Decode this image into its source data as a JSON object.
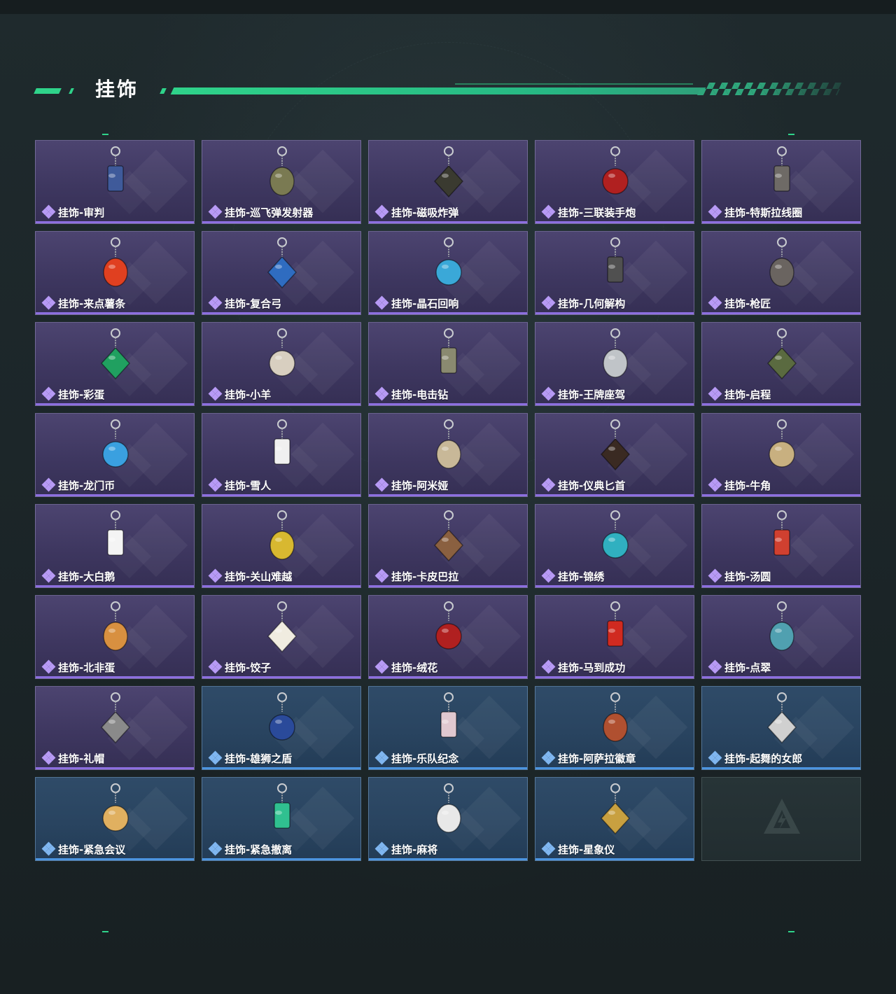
{
  "header": {
    "title": "挂饰"
  },
  "colors": {
    "accent_green": "#2fd38a",
    "rarity_purple": "#8d6fe0",
    "rarity_blue": "#4c95e0"
  },
  "items": [
    {
      "name": "挂饰-审判",
      "rarity": "purple",
      "icon": "card-tag-charm-icon",
      "color": "#3f5a9a"
    },
    {
      "name": "挂饰-巡飞弹发射器",
      "rarity": "purple",
      "icon": "launcher-charm-icon",
      "color": "#7a7a52"
    },
    {
      "name": "挂饰-磁吸炸弹",
      "rarity": "purple",
      "icon": "bomb-charm-icon",
      "color": "#3a3a30"
    },
    {
      "name": "挂饰-三联装手炮",
      "rarity": "purple",
      "icon": "hand-cannon-charm-icon",
      "color": "#b02020"
    },
    {
      "name": "挂饰-特斯拉线圈",
      "rarity": "purple",
      "icon": "tesla-coil-charm-icon",
      "color": "#6e6a66"
    },
    {
      "name": "挂饰-来点薯条",
      "rarity": "purple",
      "icon": "fries-charm-icon",
      "color": "#e04020"
    },
    {
      "name": "挂饰-复合弓",
      "rarity": "purple",
      "icon": "bow-charm-icon",
      "color": "#2f6cc0"
    },
    {
      "name": "挂饰-晶石回响",
      "rarity": "purple",
      "icon": "crystal-charm-icon",
      "color": "#3aa8d8"
    },
    {
      "name": "挂饰-几何解构",
      "rarity": "purple",
      "icon": "geometric-charm-icon",
      "color": "#505050"
    },
    {
      "name": "挂饰-枪匠",
      "rarity": "purple",
      "icon": "gunsmith-charm-icon",
      "color": "#6a6460"
    },
    {
      "name": "挂饰-彩蛋",
      "rarity": "purple",
      "icon": "egg-charm-icon",
      "color": "#20a060"
    },
    {
      "name": "挂饰-小羊",
      "rarity": "purple",
      "icon": "lamb-charm-icon",
      "color": "#d8cfc0"
    },
    {
      "name": "挂饰-电击钻",
      "rarity": "purple",
      "icon": "drill-charm-icon",
      "color": "#8a8a70"
    },
    {
      "name": "挂饰-王牌座驾",
      "rarity": "purple",
      "icon": "jet-charm-icon",
      "color": "#c0c4c8"
    },
    {
      "name": "挂饰-启程",
      "rarity": "purple",
      "icon": "emblem-charm-icon",
      "color": "#5a6a40"
    },
    {
      "name": "挂饰-龙门币",
      "rarity": "purple",
      "icon": "card-charm-icon",
      "color": "#3aa0e0"
    },
    {
      "name": "挂饰-雪人",
      "rarity": "purple",
      "icon": "snowman-charm-icon",
      "color": "#f0f0f0"
    },
    {
      "name": "挂饰-阿米娅",
      "rarity": "purple",
      "icon": "rabbit-charm-icon",
      "color": "#c8b898"
    },
    {
      "name": "挂饰-仪典匕首",
      "rarity": "purple",
      "icon": "dagger-charm-icon",
      "color": "#3a2a22"
    },
    {
      "name": "挂饰-牛角",
      "rarity": "purple",
      "icon": "horns-charm-icon",
      "color": "#c8b080"
    },
    {
      "name": "挂饰-大白鹅",
      "rarity": "purple",
      "icon": "goose-charm-icon",
      "color": "#f4f4f4"
    },
    {
      "name": "挂饰-关山难越",
      "rarity": "purple",
      "icon": "gold-bar-charm-icon",
      "color": "#d8b830"
    },
    {
      "name": "挂饰-卡皮巴拉",
      "rarity": "purple",
      "icon": "capybara-charm-icon",
      "color": "#8a6040"
    },
    {
      "name": "挂饰-锦绣",
      "rarity": "purple",
      "icon": "butterfly-charm-icon",
      "color": "#30b0c0"
    },
    {
      "name": "挂饰-汤圆",
      "rarity": "purple",
      "icon": "bowl-charm-icon",
      "color": "#d04030"
    },
    {
      "name": "挂饰-北非蛋",
      "rarity": "purple",
      "icon": "pan-charm-icon",
      "color": "#d89040"
    },
    {
      "name": "挂饰-饺子",
      "rarity": "purple",
      "icon": "dumpling-charm-icon",
      "color": "#f0ece0"
    },
    {
      "name": "挂饰-绒花",
      "rarity": "purple",
      "icon": "flower-charm-icon",
      "color": "#b02020"
    },
    {
      "name": "挂饰-马到成功",
      "rarity": "purple",
      "icon": "horse-charm-icon",
      "color": "#d02a20"
    },
    {
      "name": "挂饰-点翠",
      "rarity": "purple",
      "icon": "ornament-charm-icon",
      "color": "#50a0b0"
    },
    {
      "name": "挂饰-礼帽",
      "rarity": "purple",
      "icon": "hat-charm-icon",
      "color": "#8a8a8a"
    },
    {
      "name": "挂饰-雄狮之盾",
      "rarity": "blue",
      "icon": "shield-charm-icon",
      "color": "#2a4a9a"
    },
    {
      "name": "挂饰-乐队纪念",
      "rarity": "blue",
      "icon": "badge-charm-icon",
      "color": "#e0c8d0"
    },
    {
      "name": "挂饰-阿萨拉徽章",
      "rarity": "blue",
      "icon": "medal-charm-icon",
      "color": "#b05030"
    },
    {
      "name": "挂饰-起舞的女郎",
      "rarity": "blue",
      "icon": "dancer-charm-icon",
      "color": "#d0d0d0"
    },
    {
      "name": "挂饰-紧急会议",
      "rarity": "blue",
      "icon": "meeting-charm-icon",
      "color": "#e0b060"
    },
    {
      "name": "挂饰-紧急撤离",
      "rarity": "blue",
      "icon": "exit-charm-icon",
      "color": "#30c090"
    },
    {
      "name": "挂饰-麻将",
      "rarity": "blue",
      "icon": "mahjong-charm-icon",
      "color": "#e8e8e8"
    },
    {
      "name": "挂饰-星象仪",
      "rarity": "blue",
      "icon": "astrolabe-charm-icon",
      "color": "#c8a040"
    }
  ]
}
